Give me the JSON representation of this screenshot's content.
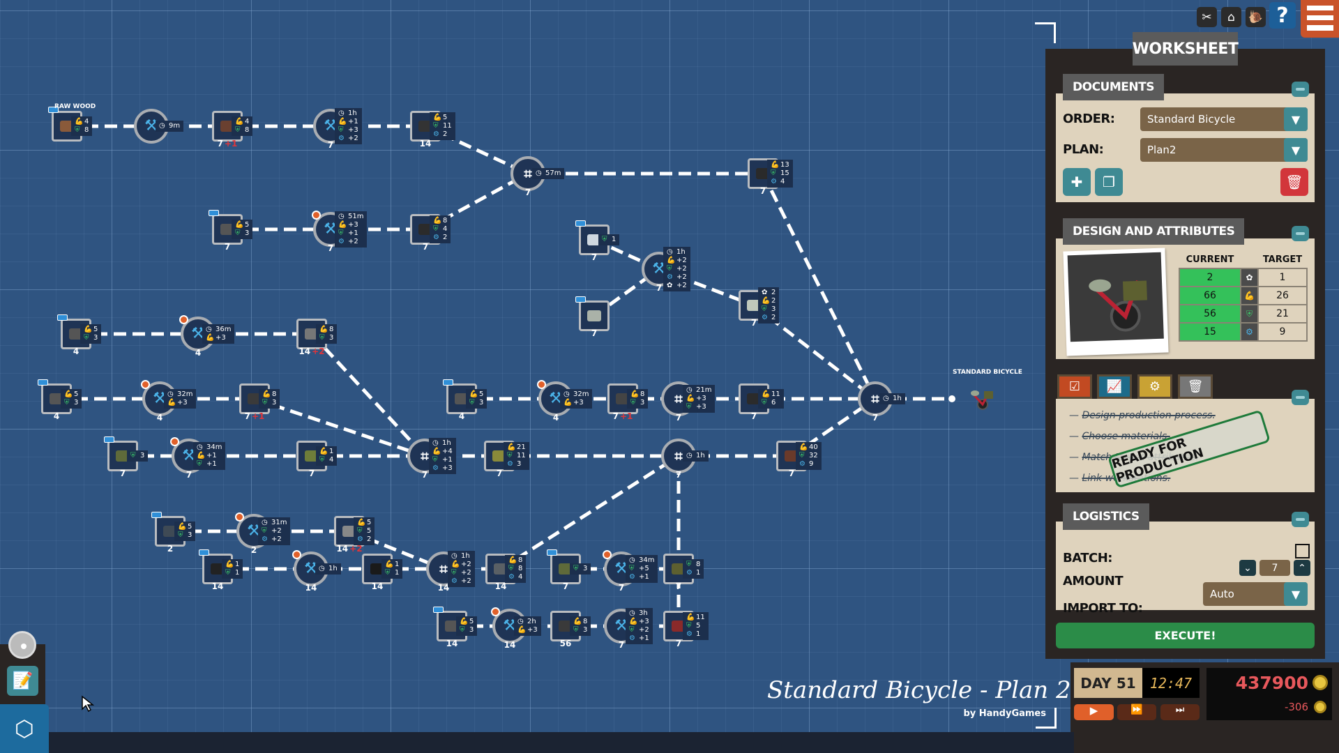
{
  "graph": {
    "product_label": "STANDARD BICYCLE",
    "raw_label": "RAW WOOD",
    "nodes": [
      {
        "k": "item",
        "ic": "raw-wood",
        "c": "#8a5a3a",
        "t": true,
        "s": [
          [
            "str",
            "4"
          ],
          [
            "dur",
            "8"
          ]
        ]
      },
      {
        "k": "station",
        "ic": "saw",
        "s": [
          [
            "time",
            "9m"
          ]
        ]
      },
      {
        "k": "item",
        "ic": "wood-block",
        "c": "#6a4030",
        "n": "7",
        "b": "+1",
        "s": [
          [
            "str",
            "4"
          ],
          [
            "dur",
            "8"
          ]
        ]
      },
      {
        "k": "station",
        "ic": "drill",
        "n": "7",
        "s": [
          [
            "time",
            "1h"
          ],
          [
            "str",
            "+1"
          ],
          [
            "dur",
            "+3"
          ],
          [
            "tech",
            "+2"
          ]
        ]
      },
      {
        "k": "item",
        "ic": "wood-part",
        "c": "#333",
        "n": "14",
        "s": [
          [
            "str",
            "5"
          ],
          [
            "dur",
            "11"
          ],
          [
            "tech",
            "2"
          ]
        ]
      },
      {
        "k": "assembly",
        "n": "7",
        "s": [
          [
            "time",
            "57m"
          ]
        ]
      },
      {
        "k": "item",
        "ic": "handlebar",
        "c": "#2a2a2a",
        "n": "7",
        "s": [
          [
            "str",
            "13"
          ],
          [
            "dur",
            "15"
          ],
          [
            "tech",
            "4"
          ]
        ]
      },
      {
        "k": "item",
        "ic": "metal-bar",
        "c": "#555",
        "t": true,
        "n": "7",
        "s": [
          [
            "str",
            "5"
          ],
          [
            "dur",
            "3"
          ]
        ]
      },
      {
        "k": "station",
        "ic": "furnace",
        "g": true,
        "n": "7",
        "s": [
          [
            "time",
            "51m"
          ],
          [
            "str",
            "+3"
          ],
          [
            "dur",
            "+1"
          ],
          [
            "tech",
            "+2"
          ]
        ]
      },
      {
        "k": "item",
        "ic": "bent-tube",
        "c": "#2b2b2b",
        "n": "7",
        "s": [
          [
            "str",
            "8"
          ],
          [
            "dur",
            "4"
          ],
          [
            "tech",
            "2"
          ]
        ]
      },
      {
        "k": "item",
        "ic": "cotton",
        "c": "#cfd8e0",
        "t": true,
        "n": "7",
        "s": [
          [
            "dur",
            "1"
          ]
        ]
      },
      {
        "k": "station",
        "ic": "sewing",
        "n": "7",
        "s": [
          [
            "time",
            "1h"
          ],
          [
            "str",
            "+2"
          ],
          [
            "dur",
            "+2"
          ],
          [
            "tech",
            "+2"
          ],
          [
            "style",
            "+2"
          ]
        ]
      },
      {
        "k": "item",
        "ic": "fabric",
        "c": "#aab2a8",
        "t": true,
        "n": "7",
        "s": []
      },
      {
        "k": "item",
        "ic": "saddle",
        "c": "#bfc8bb",
        "n": "7",
        "s": [
          [
            "style",
            "2"
          ],
          [
            "str",
            "2"
          ],
          [
            "dur",
            "3"
          ],
          [
            "tech",
            "2"
          ]
        ]
      },
      {
        "k": "item",
        "ic": "metal-bar",
        "c": "#555",
        "t": true,
        "n": "4",
        "s": [
          [
            "str",
            "5"
          ],
          [
            "dur",
            "3"
          ]
        ]
      },
      {
        "k": "station",
        "ic": "furnace",
        "g": true,
        "n": "4",
        "s": [
          [
            "time",
            "36m"
          ],
          [
            "str",
            "+3"
          ]
        ]
      },
      {
        "k": "item",
        "ic": "gear",
        "c": "#777",
        "n": "14",
        "b": "+2",
        "s": [
          [
            "str",
            "8"
          ],
          [
            "dur",
            "3"
          ]
        ]
      },
      {
        "k": "item",
        "ic": "metal-bar",
        "c": "#555",
        "t": true,
        "n": "4",
        "s": [
          [
            "str",
            "5"
          ],
          [
            "dur",
            "3"
          ]
        ]
      },
      {
        "k": "station",
        "ic": "furnace",
        "g": true,
        "n": "4",
        "s": [
          [
            "time",
            "32m"
          ],
          [
            "str",
            "+3"
          ]
        ]
      },
      {
        "k": "item",
        "ic": "chain",
        "c": "#3a3a3a",
        "n": "7",
        "b": "+1",
        "s": [
          [
            "str",
            "8"
          ],
          [
            "dur",
            "3"
          ]
        ]
      },
      {
        "k": "item",
        "ic": "plastic",
        "c": "#5f6a3a",
        "t": true,
        "n": "7",
        "s": [
          [
            "dur",
            "3"
          ]
        ]
      },
      {
        "k": "station",
        "ic": "molding",
        "g": true,
        "n": "7",
        "s": [
          [
            "time",
            "34m"
          ],
          [
            "str",
            "+1"
          ],
          [
            "dur",
            "+1"
          ]
        ]
      },
      {
        "k": "item",
        "ic": "pedal",
        "c": "#6e7d3a",
        "n": "7",
        "s": [
          [
            "str",
            "1"
          ],
          [
            "dur",
            "4"
          ]
        ]
      },
      {
        "k": "assembly",
        "n": "7",
        "s": [
          [
            "time",
            "1h"
          ],
          [
            "str",
            "+4"
          ],
          [
            "dur",
            "+1"
          ],
          [
            "tech",
            "+3"
          ]
        ]
      },
      {
        "k": "item",
        "ic": "drivetrain",
        "c": "#8a8a3a",
        "n": "7",
        "s": [
          [
            "str",
            "21"
          ],
          [
            "dur",
            "11"
          ],
          [
            "tech",
            "3"
          ]
        ]
      },
      {
        "k": "assembly",
        "n": "7",
        "s": [
          [
            "time",
            "1h"
          ]
        ]
      },
      {
        "k": "item",
        "ic": "frame-set",
        "c": "#6a3a2a",
        "n": "7",
        "s": [
          [
            "str",
            "40"
          ],
          [
            "dur",
            "32"
          ],
          [
            "tech",
            "9"
          ]
        ]
      },
      {
        "k": "item",
        "ic": "metal-bar",
        "c": "#555",
        "t": true,
        "n": "4",
        "s": [
          [
            "str",
            "5"
          ],
          [
            "dur",
            "3"
          ]
        ]
      },
      {
        "k": "station",
        "ic": "furnace",
        "g": true,
        "n": "4",
        "s": [
          [
            "time",
            "32m"
          ],
          [
            "str",
            "+3"
          ]
        ]
      },
      {
        "k": "item",
        "ic": "rod",
        "c": "#444",
        "n": "7",
        "b": "+1",
        "s": [
          [
            "str",
            "8"
          ],
          [
            "dur",
            "3"
          ]
        ]
      },
      {
        "k": "assembly",
        "n": "7",
        "s": [
          [
            "time",
            "21m"
          ],
          [
            "str",
            "+3"
          ],
          [
            "dur",
            "+3"
          ]
        ]
      },
      {
        "k": "item",
        "ic": "fork",
        "c": "#2b2b2b",
        "n": "7",
        "s": [
          [
            "str",
            "11"
          ],
          [
            "dur",
            "6"
          ]
        ]
      },
      {
        "k": "assembly",
        "n": "7",
        "s": [
          [
            "time",
            "1h"
          ]
        ]
      },
      {
        "k": "item",
        "ic": "metal-block",
        "c": "#3f4a55",
        "t": true,
        "n": "2",
        "s": [
          [
            "str",
            "5"
          ],
          [
            "dur",
            "3"
          ]
        ]
      },
      {
        "k": "station",
        "ic": "furnace-plus",
        "g": true,
        "n": "2",
        "s": [
          [
            "time",
            "31m"
          ],
          [
            "dur",
            "+2"
          ],
          [
            "tech",
            "+2"
          ]
        ]
      },
      {
        "k": "item",
        "ic": "rim",
        "c": "#888",
        "n": "14",
        "b": "+2",
        "s": [
          [
            "str",
            "5"
          ],
          [
            "dur",
            "5"
          ],
          [
            "tech",
            "2"
          ]
        ]
      },
      {
        "k": "item",
        "ic": "rubber",
        "c": "#222",
        "t": true,
        "n": "14",
        "s": [
          [
            "str",
            "1"
          ],
          [
            "dur",
            "1"
          ]
        ]
      },
      {
        "k": "station",
        "ic": "vulcanizer",
        "g": true,
        "n": "14",
        "s": [
          [
            "time",
            "1h"
          ]
        ]
      },
      {
        "k": "item",
        "ic": "tire",
        "c": "#1a1a1a",
        "n": "14",
        "s": [
          [
            "str",
            "1"
          ],
          [
            "dur",
            "1"
          ]
        ]
      },
      {
        "k": "assembly",
        "n": "14",
        "s": [
          [
            "time",
            "1h"
          ],
          [
            "str",
            "+2"
          ],
          [
            "dur",
            "+2"
          ],
          [
            "tech",
            "+2"
          ]
        ]
      },
      {
        "k": "item",
        "ic": "wheel",
        "c": "#5a6065",
        "n": "14",
        "s": [
          [
            "str",
            "8"
          ],
          [
            "dur",
            "8"
          ],
          [
            "tech",
            "4"
          ]
        ]
      },
      {
        "k": "item",
        "ic": "plastic",
        "c": "#5f6a3a",
        "t": true,
        "n": "7",
        "s": [
          [
            "dur",
            "3"
          ]
        ]
      },
      {
        "k": "station",
        "ic": "molding",
        "g": true,
        "n": "7",
        "s": [
          [
            "time",
            "34m"
          ],
          [
            "dur",
            "+5"
          ],
          [
            "tech",
            "+1"
          ]
        ]
      },
      {
        "k": "item",
        "ic": "basket",
        "c": "#5d6030",
        "n": "7",
        "s": [
          [
            "dur",
            "8"
          ],
          [
            "tech",
            "1"
          ]
        ]
      },
      {
        "k": "item",
        "ic": "metal-bar",
        "c": "#555",
        "t": true,
        "n": "14",
        "s": [
          [
            "str",
            "5"
          ],
          [
            "dur",
            "3"
          ]
        ]
      },
      {
        "k": "station",
        "ic": "furnace",
        "g": true,
        "n": "14",
        "s": [
          [
            "time",
            "2h"
          ],
          [
            "str",
            "+3"
          ]
        ]
      },
      {
        "k": "item",
        "ic": "tube",
        "c": "#3a3a3a",
        "n": "56",
        "s": [
          [
            "str",
            "8"
          ],
          [
            "dur",
            "3"
          ]
        ]
      },
      {
        "k": "station",
        "ic": "welder",
        "n": "7",
        "s": [
          [
            "time",
            "3h"
          ],
          [
            "str",
            "+3"
          ],
          [
            "dur",
            "+2"
          ],
          [
            "tech",
            "+1"
          ]
        ]
      },
      {
        "k": "item",
        "ic": "frame",
        "c": "#8a2a2a",
        "n": "7",
        "s": [
          [
            "str",
            "11"
          ],
          [
            "dur",
            "5"
          ],
          [
            "tech",
            "1"
          ]
        ]
      }
    ]
  },
  "stat_icons": {
    "time": "timer-icon",
    "str": "strength-icon",
    "dur": "durability-icon",
    "tech": "tech-icon",
    "style": "style-icon"
  },
  "colors": {
    "str": "#e0353a",
    "dur": "#3cc86a",
    "tech": "#4bb3e8",
    "style": "#ffffff",
    "time": "#ffffff",
    "accent": "#e0602a",
    "execute": "#2b8c48"
  },
  "worksheet": {
    "title": "WORKSHEET",
    "documents": {
      "title": "DOCUMENTS",
      "order_label": "ORDER:",
      "order_value": "Standard Bicycle",
      "plan_label": "PLAN:",
      "plan_value": "Plan2"
    },
    "design": {
      "title": "DESIGN AND ATTRIBUTES",
      "current_header": "CURRENT",
      "target_header": "TARGET",
      "rows": [
        {
          "current": "2",
          "icon": "style-icon",
          "target": "1"
        },
        {
          "current": "66",
          "icon": "strength-icon",
          "target": "26"
        },
        {
          "current": "56",
          "icon": "durability-icon",
          "target": "21"
        },
        {
          "current": "15",
          "icon": "tech-icon",
          "target": "9"
        }
      ]
    },
    "checklist": {
      "items": [
        "Design production process.",
        "Choose materials.",
        "Match target attributes.",
        "Link workstations."
      ],
      "stamp": "READY FOR PRODUCTION"
    },
    "logistics": {
      "title": "LOGISTICS",
      "batch_label": "BATCH:",
      "batch_checked": false,
      "amount_label": "AMOUNT",
      "amount": "7",
      "import_label": "IMPORT TO:",
      "import_value": "Auto"
    },
    "execute": "EXECUTE!"
  },
  "status": {
    "day": "DAY 51",
    "time": "12:47",
    "money": "437900",
    "delta": "-306"
  },
  "plan_title": "Standard Bicycle - Plan 2",
  "credit": "by HandyGames"
}
